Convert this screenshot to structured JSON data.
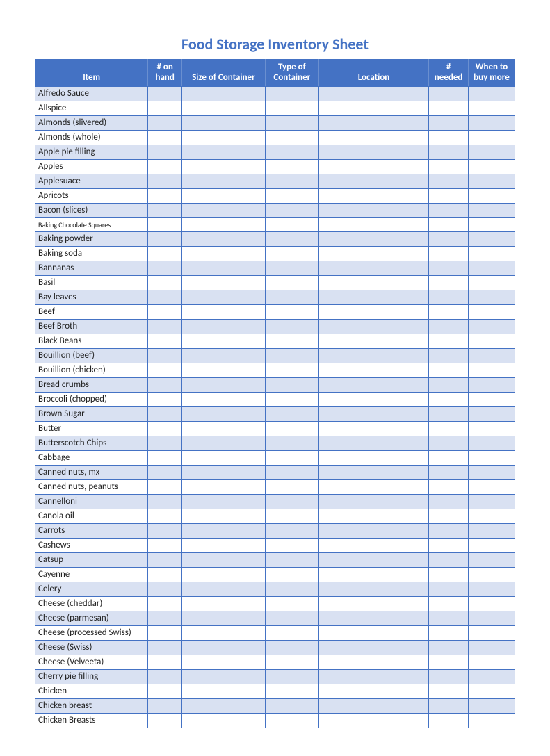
{
  "title": "Food Storage Inventory Sheet",
  "columns": [
    {
      "key": "item",
      "label": "Item"
    },
    {
      "key": "on_hand",
      "label": "# on\nhand"
    },
    {
      "key": "size",
      "label": "Size of Container"
    },
    {
      "key": "type",
      "label": "Type of\nContainer"
    },
    {
      "key": "location",
      "label": "Location"
    },
    {
      "key": "needed",
      "label": "#\nneeded"
    },
    {
      "key": "when",
      "label": "When to\nbuy more"
    }
  ],
  "rows": [
    {
      "item": "Alfredo Sauce",
      "on_hand": "",
      "size": "",
      "type": "",
      "location": "",
      "needed": "",
      "when": ""
    },
    {
      "item": "Allspice",
      "on_hand": "",
      "size": "",
      "type": "",
      "location": "",
      "needed": "",
      "when": ""
    },
    {
      "item": "Almonds (slivered)",
      "on_hand": "",
      "size": "",
      "type": "",
      "location": "",
      "needed": "",
      "when": ""
    },
    {
      "item": "Almonds (whole)",
      "on_hand": "",
      "size": "",
      "type": "",
      "location": "",
      "needed": "",
      "when": ""
    },
    {
      "item": "Apple pie filling",
      "on_hand": "",
      "size": "",
      "type": "",
      "location": "",
      "needed": "",
      "when": ""
    },
    {
      "item": "Apples",
      "on_hand": "",
      "size": "",
      "type": "",
      "location": "",
      "needed": "",
      "when": ""
    },
    {
      "item": "Applesuace",
      "on_hand": "",
      "size": "",
      "type": "",
      "location": "",
      "needed": "",
      "when": ""
    },
    {
      "item": "Apricots",
      "on_hand": "",
      "size": "",
      "type": "",
      "location": "",
      "needed": "",
      "when": ""
    },
    {
      "item": "Bacon (slices)",
      "on_hand": "",
      "size": "",
      "type": "",
      "location": "",
      "needed": "",
      "when": ""
    },
    {
      "item": "Baking Chocolate Squares",
      "on_hand": "",
      "size": "",
      "type": "",
      "location": "",
      "needed": "",
      "when": "",
      "small": true
    },
    {
      "item": "Baking powder",
      "on_hand": "",
      "size": "",
      "type": "",
      "location": "",
      "needed": "",
      "when": ""
    },
    {
      "item": "Baking soda",
      "on_hand": "",
      "size": "",
      "type": "",
      "location": "",
      "needed": "",
      "when": ""
    },
    {
      "item": "Bannanas",
      "on_hand": "",
      "size": "",
      "type": "",
      "location": "",
      "needed": "",
      "when": ""
    },
    {
      "item": "Basil",
      "on_hand": "",
      "size": "",
      "type": "",
      "location": "",
      "needed": "",
      "when": ""
    },
    {
      "item": "Bay leaves",
      "on_hand": "",
      "size": "",
      "type": "",
      "location": "",
      "needed": "",
      "when": ""
    },
    {
      "item": "Beef",
      "on_hand": "",
      "size": "",
      "type": "",
      "location": "",
      "needed": "",
      "when": ""
    },
    {
      "item": "Beef Broth",
      "on_hand": "",
      "size": "",
      "type": "",
      "location": "",
      "needed": "",
      "when": ""
    },
    {
      "item": "Black Beans",
      "on_hand": "",
      "size": "",
      "type": "",
      "location": "",
      "needed": "",
      "when": ""
    },
    {
      "item": "Bouillion (beef)",
      "on_hand": "",
      "size": "",
      "type": "",
      "location": "",
      "needed": "",
      "when": ""
    },
    {
      "item": "Bouillion (chicken)",
      "on_hand": "",
      "size": "",
      "type": "",
      "location": "",
      "needed": "",
      "when": ""
    },
    {
      "item": "Bread crumbs",
      "on_hand": "",
      "size": "",
      "type": "",
      "location": "",
      "needed": "",
      "when": ""
    },
    {
      "item": "Broccoli (chopped)",
      "on_hand": "",
      "size": "",
      "type": "",
      "location": "",
      "needed": "",
      "when": ""
    },
    {
      "item": "Brown Sugar",
      "on_hand": "",
      "size": "",
      "type": "",
      "location": "",
      "needed": "",
      "when": ""
    },
    {
      "item": "Butter",
      "on_hand": "",
      "size": "",
      "type": "",
      "location": "",
      "needed": "",
      "when": ""
    },
    {
      "item": "Butterscotch Chips",
      "on_hand": "",
      "size": "",
      "type": "",
      "location": "",
      "needed": "",
      "when": ""
    },
    {
      "item": "Cabbage",
      "on_hand": "",
      "size": "",
      "type": "",
      "location": "",
      "needed": "",
      "when": ""
    },
    {
      "item": "Canned nuts, mx",
      "on_hand": "",
      "size": "",
      "type": "",
      "location": "",
      "needed": "",
      "when": ""
    },
    {
      "item": "Canned nuts, peanuts",
      "on_hand": "",
      "size": "",
      "type": "",
      "location": "",
      "needed": "",
      "when": ""
    },
    {
      "item": "Cannelloni",
      "on_hand": "",
      "size": "",
      "type": "",
      "location": "",
      "needed": "",
      "when": ""
    },
    {
      "item": "Canola oil",
      "on_hand": "",
      "size": "",
      "type": "",
      "location": "",
      "needed": "",
      "when": ""
    },
    {
      "item": "Carrots",
      "on_hand": "",
      "size": "",
      "type": "",
      "location": "",
      "needed": "",
      "when": ""
    },
    {
      "item": "Cashews",
      "on_hand": "",
      "size": "",
      "type": "",
      "location": "",
      "needed": "",
      "when": ""
    },
    {
      "item": "Catsup",
      "on_hand": "",
      "size": "",
      "type": "",
      "location": "",
      "needed": "",
      "when": ""
    },
    {
      "item": "Cayenne",
      "on_hand": "",
      "size": "",
      "type": "",
      "location": "",
      "needed": "",
      "when": ""
    },
    {
      "item": "Celery",
      "on_hand": "",
      "size": "",
      "type": "",
      "location": "",
      "needed": "",
      "when": ""
    },
    {
      "item": "Cheese (cheddar)",
      "on_hand": "",
      "size": "",
      "type": "",
      "location": "",
      "needed": "",
      "when": ""
    },
    {
      "item": "Cheese (parmesan)",
      "on_hand": "",
      "size": "",
      "type": "",
      "location": "",
      "needed": "",
      "when": ""
    },
    {
      "item": "Cheese (processed Swiss)",
      "on_hand": "",
      "size": "",
      "type": "",
      "location": "",
      "needed": "",
      "when": ""
    },
    {
      "item": "Cheese (Swiss)",
      "on_hand": "",
      "size": "",
      "type": "",
      "location": "",
      "needed": "",
      "when": ""
    },
    {
      "item": "Cheese (Velveeta)",
      "on_hand": "",
      "size": "",
      "type": "",
      "location": "",
      "needed": "",
      "when": ""
    },
    {
      "item": "Cherry pie filling",
      "on_hand": "",
      "size": "",
      "type": "",
      "location": "",
      "needed": "",
      "when": ""
    },
    {
      "item": "Chicken",
      "on_hand": "",
      "size": "",
      "type": "",
      "location": "",
      "needed": "",
      "when": ""
    },
    {
      "item": "Chicken breast",
      "on_hand": "",
      "size": "",
      "type": "",
      "location": "",
      "needed": "",
      "when": ""
    },
    {
      "item": "Chicken Breasts",
      "on_hand": "",
      "size": "",
      "type": "",
      "location": "",
      "needed": "",
      "when": ""
    }
  ]
}
